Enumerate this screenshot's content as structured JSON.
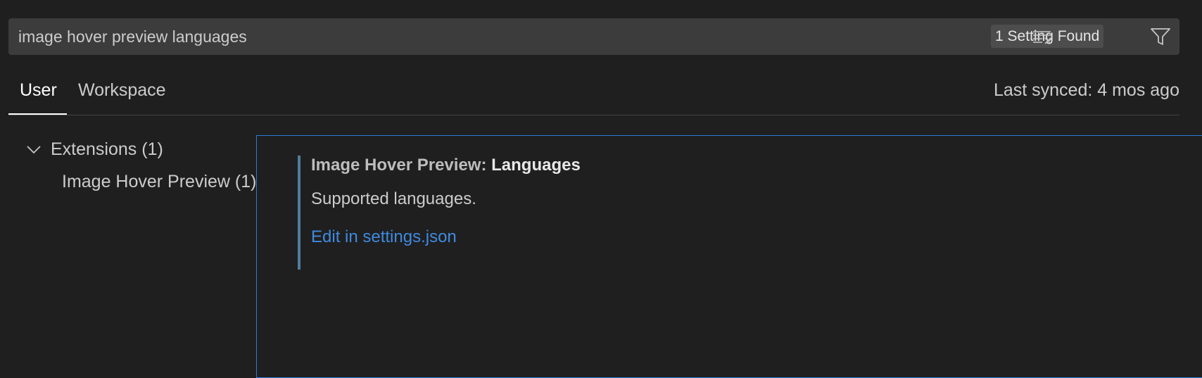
{
  "search": {
    "value": "image hover preview languages",
    "result_count": "1 Setting Found",
    "clear_icon": "clear-filter-icon",
    "filter_icon": "filter-icon"
  },
  "tabs": {
    "user": "User",
    "workspace": "Workspace",
    "active": "User",
    "sync_status": "Last synced: 4 mos ago"
  },
  "toc": {
    "group_label": "Extensions (1)",
    "group_icon": "chevron-down-icon",
    "item_label": "Image Hover Preview (1)"
  },
  "setting": {
    "category": "Image Hover Preview: ",
    "key": "Languages",
    "description": "Supported languages.",
    "link": "Edit in settings.json"
  },
  "colors": {
    "background": "#1f1f1f",
    "search_bg": "#3c3c3c",
    "focus_border": "#2b79d8",
    "modified_indicator": "#4f7e9e",
    "link": "#3f8ae0"
  }
}
